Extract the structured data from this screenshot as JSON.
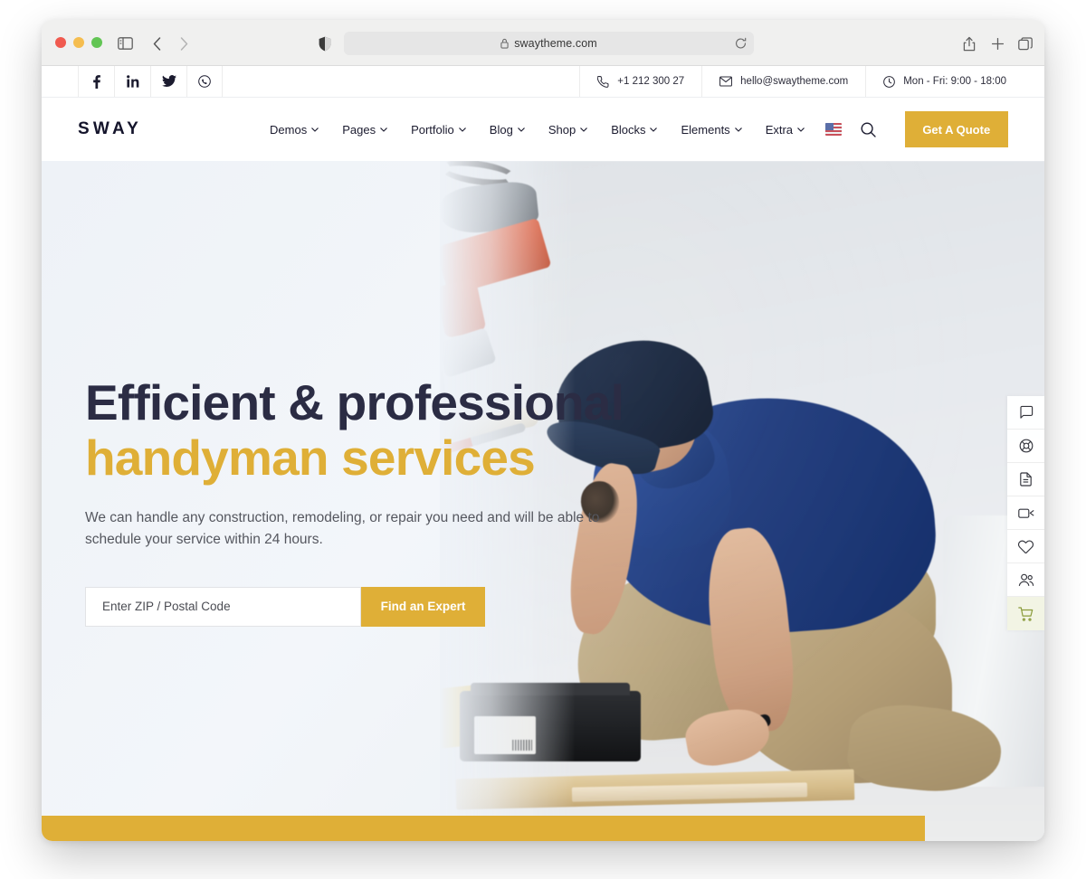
{
  "browser": {
    "url": "swaytheme.com",
    "lock_icon": "lock-icon",
    "reload_icon": "reload-icon",
    "sidebar_icon": "sidebar-toggle-icon",
    "back_icon": "chevron-left-icon",
    "forward_icon": "chevron-right-icon",
    "shield_icon": "privacy-shield-icon",
    "share_icon": "share-icon",
    "newtab_icon": "plus-icon",
    "tabs_icon": "tabs-overview-icon",
    "traffic_lights": [
      "close",
      "minimize",
      "maximize"
    ]
  },
  "topbar": {
    "socials": [
      {
        "name": "facebook-icon",
        "label": "f"
      },
      {
        "name": "linkedin-icon",
        "label": "in"
      },
      {
        "name": "twitter-icon",
        "label": "twitter"
      },
      {
        "name": "whatsapp-icon",
        "label": "whatsapp"
      }
    ],
    "phone": "+1 212 300 27",
    "email": "hello@swaytheme.com",
    "hours": "Mon - Fri: 9:00 - 18:00"
  },
  "header": {
    "logo": "SWAY",
    "nav": [
      {
        "label": "Demos",
        "has_dropdown": true
      },
      {
        "label": "Pages",
        "has_dropdown": true
      },
      {
        "label": "Portfolio",
        "has_dropdown": true
      },
      {
        "label": "Blog",
        "has_dropdown": true
      },
      {
        "label": "Shop",
        "has_dropdown": true
      },
      {
        "label": "Blocks",
        "has_dropdown": true
      },
      {
        "label": "Elements",
        "has_dropdown": true
      },
      {
        "label": "Extra",
        "has_dropdown": true
      }
    ],
    "language_flag": "us-flag-icon",
    "search_icon": "search-icon",
    "cta_label": "Get A Quote"
  },
  "hero": {
    "title_line1": "Efficient & professional",
    "title_line2": "handyman services",
    "subtitle": "We can handle any construction, remodeling, or repair you need and will be able to schedule your service within 24 hours.",
    "zip_placeholder": "Enter ZIP / Postal Code",
    "zip_value": "",
    "submit_label": "Find an Expert"
  },
  "side_rail": [
    {
      "name": "chat-icon",
      "active": false
    },
    {
      "name": "lifebuoy-support-icon",
      "active": false
    },
    {
      "name": "document-icon",
      "active": false
    },
    {
      "name": "video-camera-icon",
      "active": false
    },
    {
      "name": "heart-icon",
      "active": false
    },
    {
      "name": "users-icon",
      "active": false
    },
    {
      "name": "shopping-cart-icon",
      "active": true
    }
  ],
  "colors": {
    "accent_gold": "#dfaf37",
    "heading_navy": "#2b2c44",
    "body_text": "#55575f",
    "rail_active_bg": "#f2f4e4",
    "rail_active_fg": "#8a9b3a"
  }
}
